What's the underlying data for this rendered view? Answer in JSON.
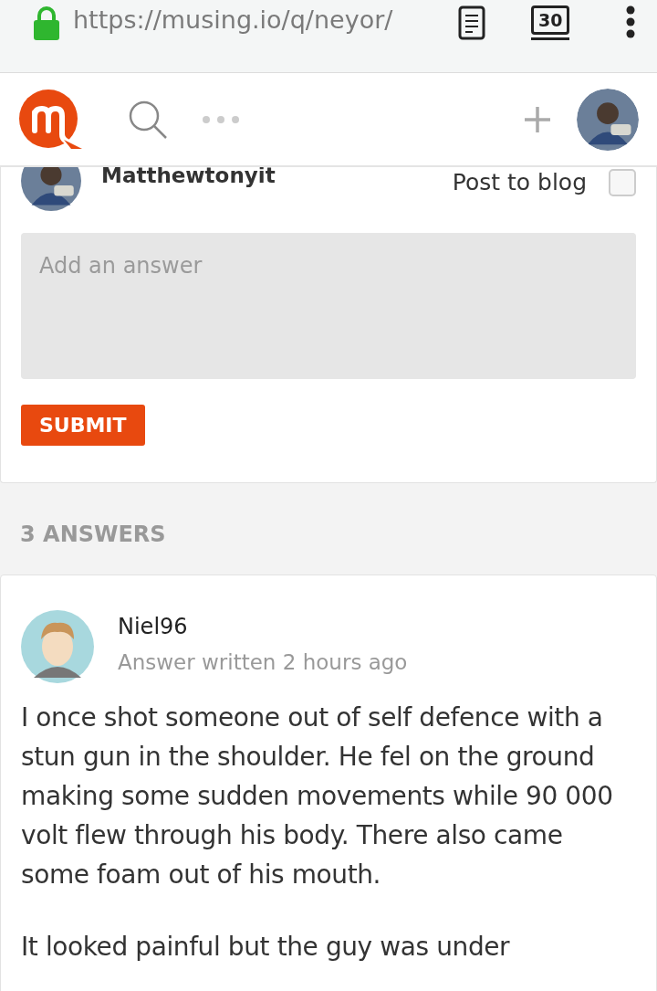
{
  "browser_bar": {
    "url": "https://musing.io/q/neyor/",
    "tab_count": "30"
  },
  "composer": {
    "username": "Matthewtonyit",
    "post_to_blog": {
      "label": "Post to blog",
      "checked": false
    },
    "answer_field": {
      "placeholder": "Add an answer"
    },
    "submit": "SUBMIT"
  },
  "answers_heading": "3 ANSWERS",
  "answers": [
    {
      "author": "Niel96",
      "meta": "Answer written 2 hours ago",
      "paragraphs": [
        "I once shot someone out of self defence with a stun gun in the shoulder. He fel on the ground making some sudden movements while 90 000 volt flew through his body. There also came some foam out of his mouth.",
        "It looked painful but the guy was under"
      ]
    }
  ]
}
